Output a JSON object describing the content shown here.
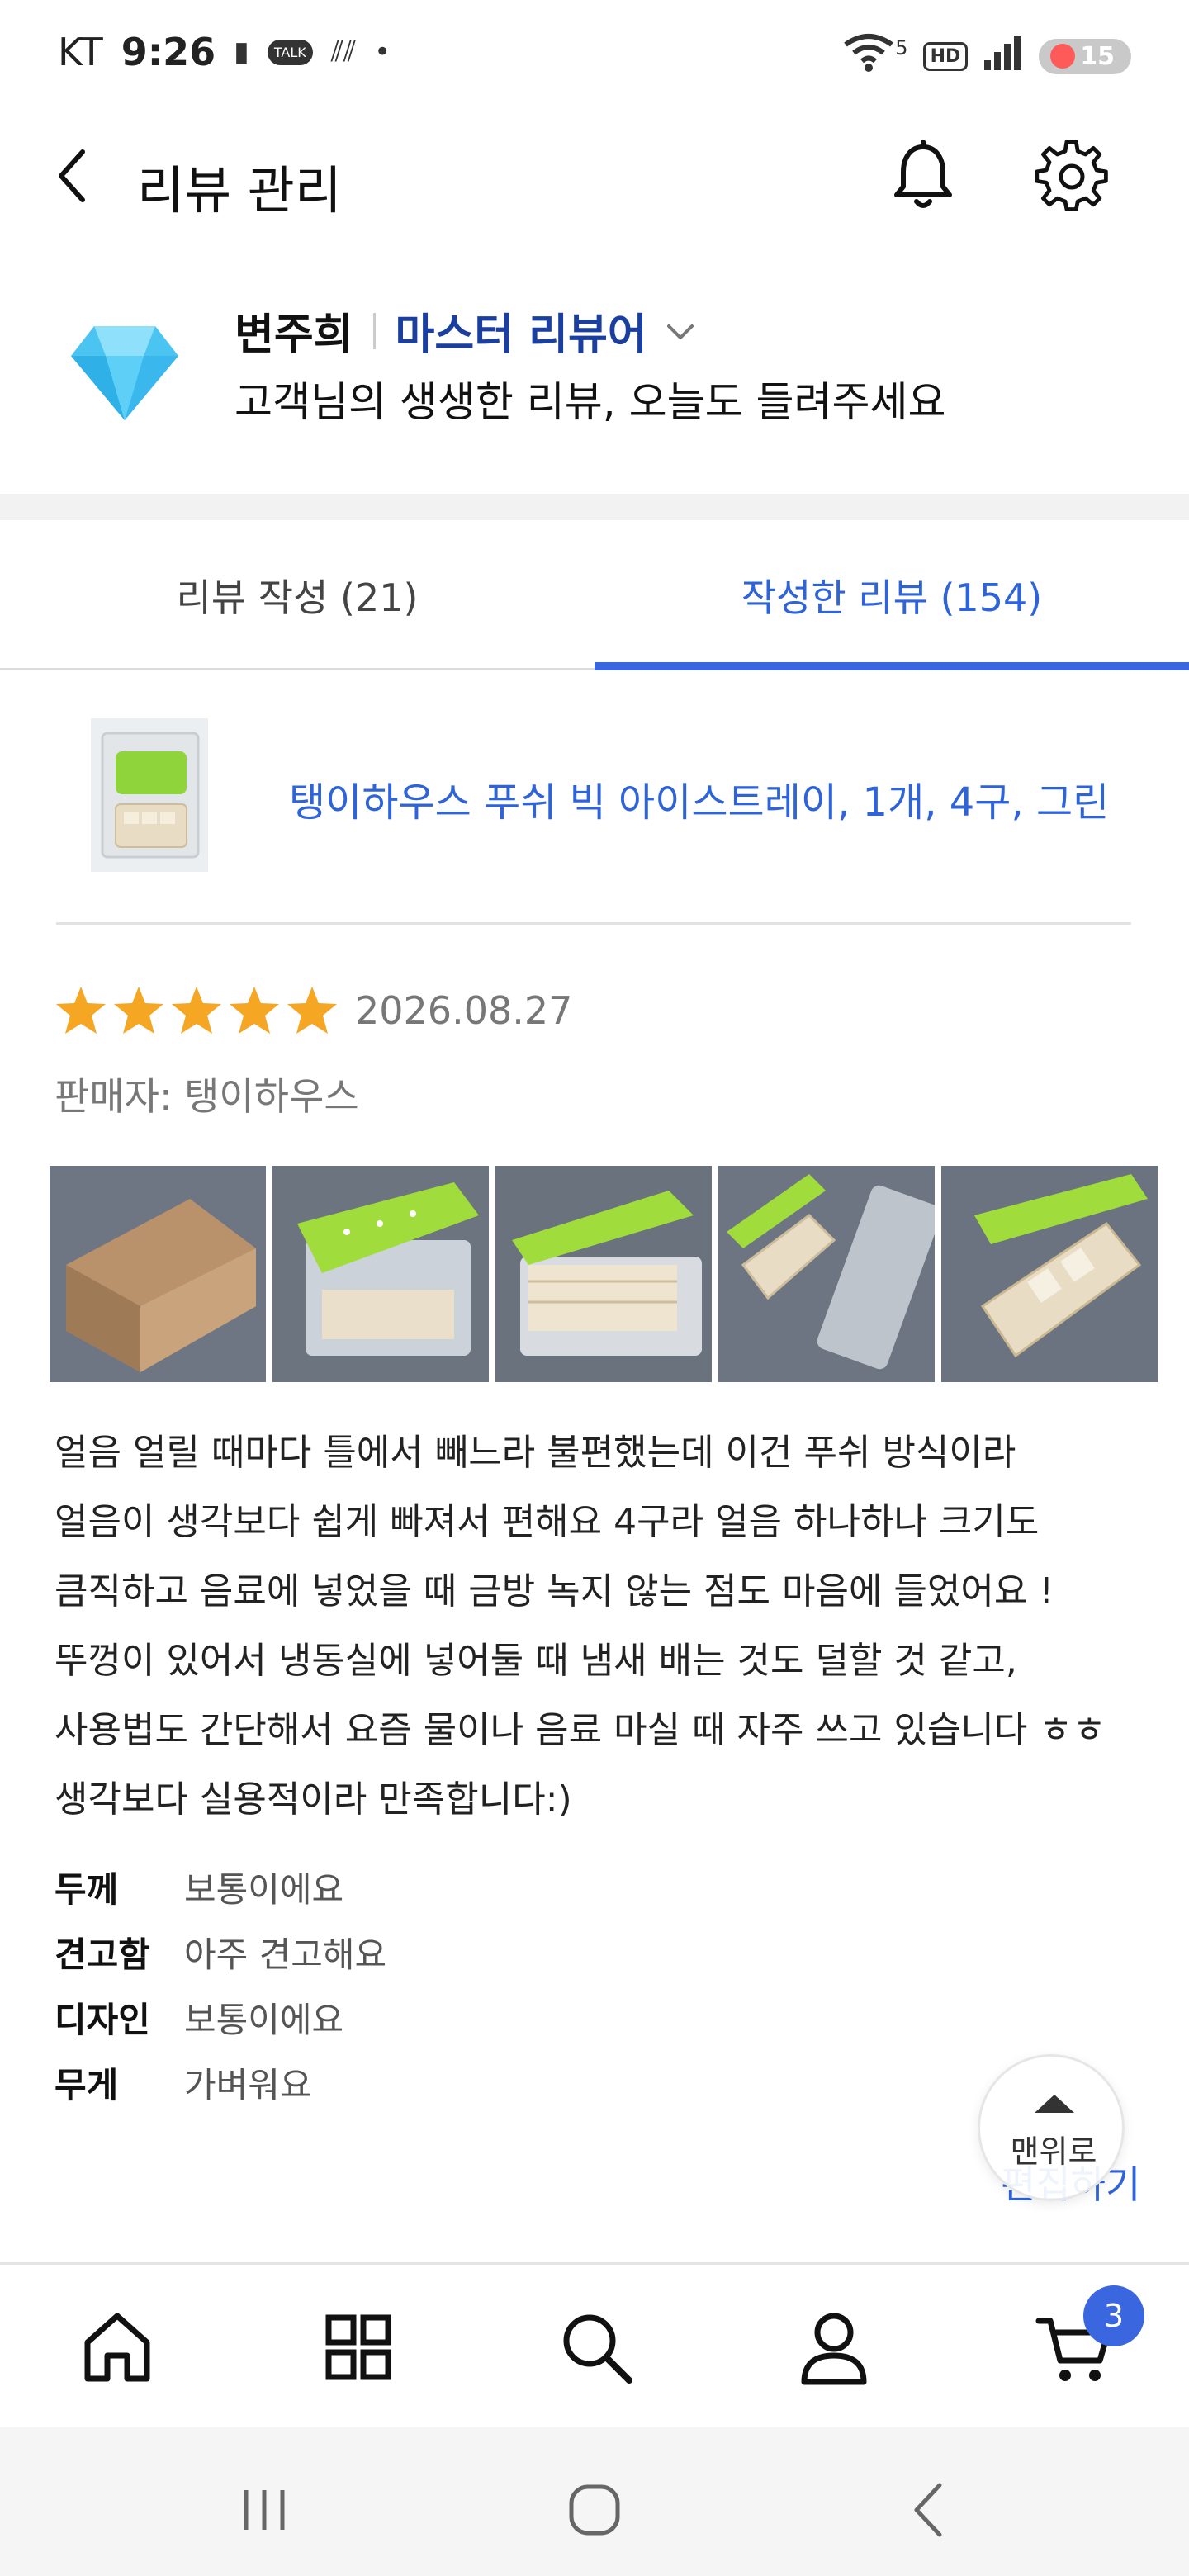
{
  "status_bar": {
    "carrier": "KT",
    "time": "9:26",
    "battery_level": "15",
    "network": "5",
    "hd": "HD",
    "talk": "TALK"
  },
  "header": {
    "title": "리뷰 관리"
  },
  "profile": {
    "name": "변주희",
    "grade": "마스터 리뷰어",
    "subtitle": "고객님의 생생한 리뷰, 오늘도 들려주세요"
  },
  "tabs": [
    {
      "label": "리뷰 작성 (21)",
      "active": false
    },
    {
      "label": "작성한 리뷰 (154)",
      "active": true
    }
  ],
  "review": {
    "product_name": "탱이하우스 푸쉬 빅 아이스트레이, 1개, 4구, 그린",
    "rating": 5,
    "date": "2026.08.27",
    "seller_label": "판매자: ",
    "seller_name": "탱이하우스",
    "photo_count": 5,
    "text_lines": [
      "얼음 얼릴 때마다 틀에서 빼느라 불편했는데 이건 푸쉬 방식이라",
      "얼음이 생각보다 쉽게 빠져서 편해요 4구라 얼음 하나하나 크기도",
      "큼직하고 음료에 넣었을 때 금방 녹지 않는 점도 마음에 들었어요 !",
      "뚜껑이 있어서 냉동실에 넣어둘 때 냄새 배는 것도 덜할 것 같고,",
      "사용법도 간단해서 요즘 물이나 음료 마실 때 자주 쓰고 있습니다 ㅎㅎ",
      "생각보다 실용적이라 만족합니다:)"
    ],
    "attributes": [
      {
        "key": "두께",
        "value": "보통이에요"
      },
      {
        "key": "견고함",
        "value": "아주 견고해요"
      },
      {
        "key": "디자인",
        "value": "보통이에요"
      },
      {
        "key": "무게",
        "value": "가벼워요"
      }
    ],
    "edit_label": "편집하기"
  },
  "scroll_top_label": "맨위로",
  "bottom_nav": {
    "items": [
      "home-icon",
      "category-grid-icon",
      "search-icon",
      "profile-icon",
      "cart-icon"
    ],
    "cart_count": "3"
  },
  "colors": {
    "accent": "#3a66e0",
    "grade": "#1b3f9e",
    "star": "#f5a623",
    "diamond": "#4cc4f2"
  }
}
